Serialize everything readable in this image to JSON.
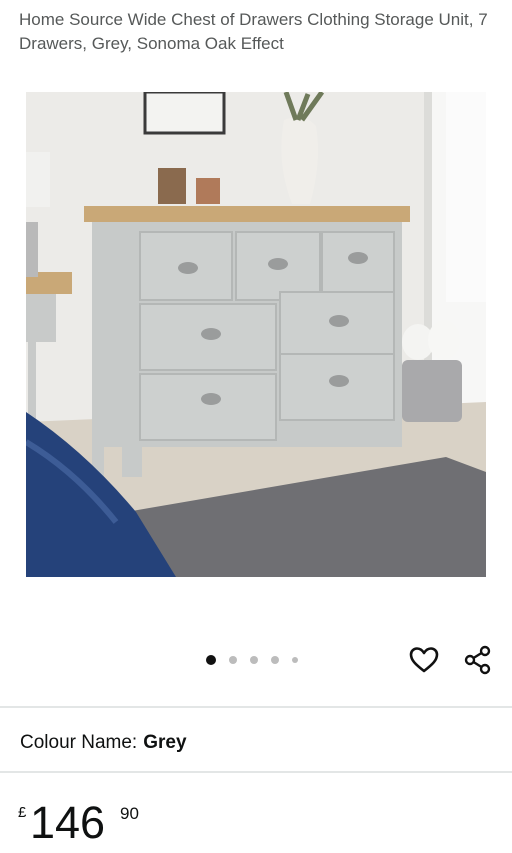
{
  "product": {
    "title": "Home Source Wide Chest of Drawers Clothing Storage Unit, 7 Drawers, Grey, Sonoma Oak Effect",
    "image": {
      "icon": "chest-of-drawers-photo",
      "slide_index": 1,
      "slide_count": 5
    }
  },
  "actions": {
    "wishlist_icon": "heart-icon",
    "share_icon": "share-icon"
  },
  "variation": {
    "label": "Colour Name:",
    "value": "Grey"
  },
  "price": {
    "currency": "£",
    "whole": "146",
    "fraction": "90"
  },
  "colors": {
    "text": "#0f1111",
    "subtext": "#565959",
    "dot_active": "#111111",
    "dot_inactive": "#bcbcbc"
  }
}
